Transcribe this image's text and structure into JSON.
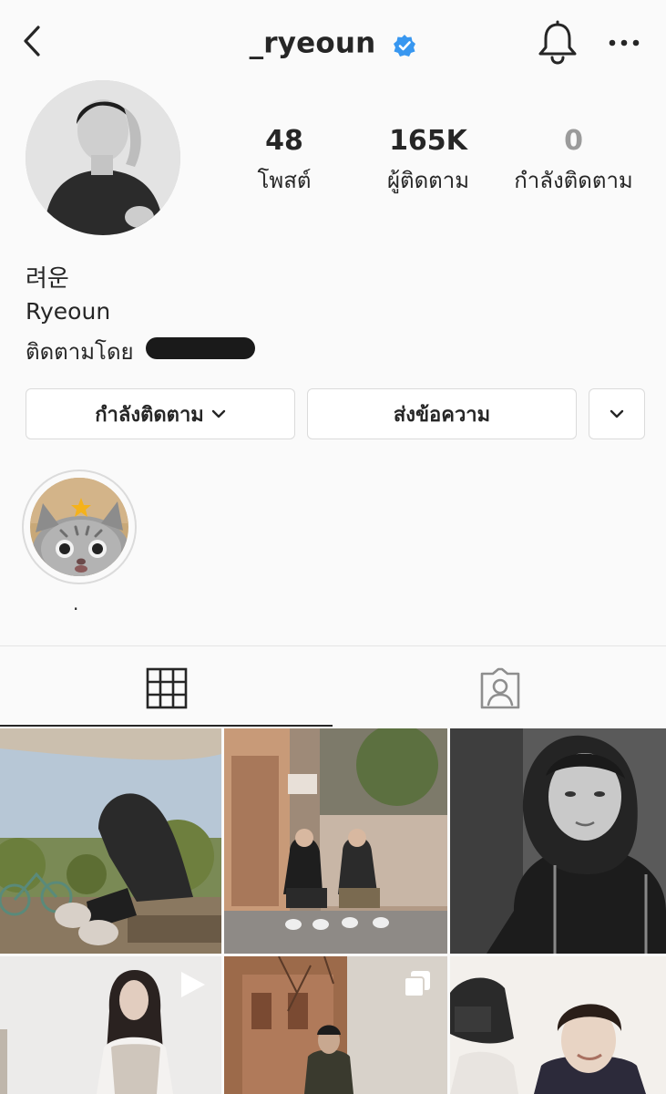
{
  "header": {
    "username": "_ryeoun",
    "icons": {
      "back": "chevron-left-icon",
      "verified": "verified-badge-icon",
      "notifications": "bell-icon",
      "more": "more-horizontal-icon"
    },
    "accent_color": "#3897f0"
  },
  "stats": {
    "posts": {
      "value": "48",
      "label": "โพสต์"
    },
    "followers": {
      "value": "165K",
      "label": "ผู้ติดตาม"
    },
    "following": {
      "value": "0",
      "label": "กำลังติดตาม"
    }
  },
  "bio": {
    "display_name": "려운",
    "name": "Ryeoun",
    "followed_by": "ติดตามโดย"
  },
  "actions": {
    "following_label": "กำลังติดตาม",
    "message_label": "ส่งข้อความ"
  },
  "highlights": [
    {
      "label": "."
    }
  ],
  "tabs": [
    {
      "name": "grid",
      "icon": "grid-icon"
    },
    {
      "name": "tagged",
      "icon": "tagged-person-icon"
    }
  ],
  "grid_posts": [
    {
      "type": "photo"
    },
    {
      "type": "photo"
    },
    {
      "type": "photo"
    },
    {
      "type": "video"
    },
    {
      "type": "carousel"
    },
    {
      "type": "photo"
    }
  ]
}
